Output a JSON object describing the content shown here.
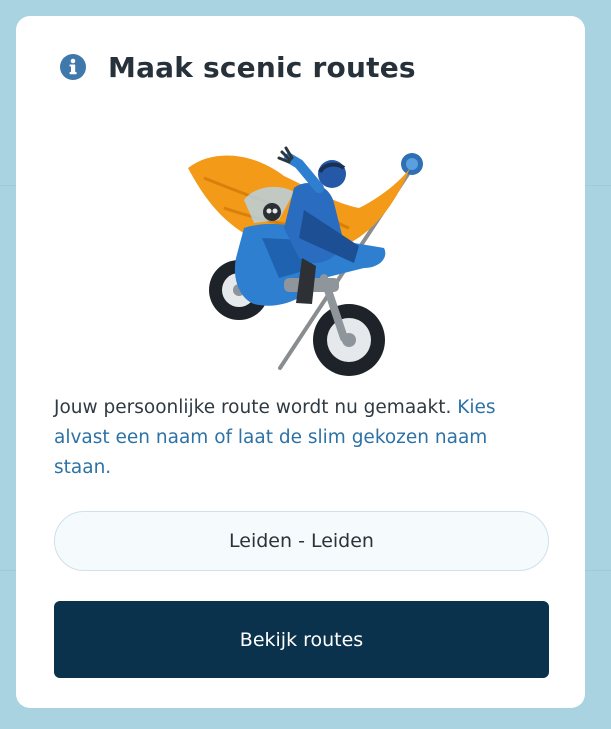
{
  "dialog": {
    "icon": "info-icon",
    "title": "Maak scenic routes",
    "illustration": "motorcycle-rider-with-flag",
    "message_plain": "Jouw persoonlijke route wordt nu gemaakt. ",
    "message_highlight": "Kies alvast een naam of laat de slim gekozen naam staan.",
    "route_name_value": "Leiden - Leiden",
    "primary_button_label": "Bekijk routes"
  },
  "colors": {
    "backdrop": "#a9d3e0",
    "card": "#ffffff",
    "title_text": "#27313a",
    "info_icon": "#3f78aa",
    "highlight_text": "#2d72a6",
    "input_background": "#f5fafd",
    "input_border": "#cfe1ec",
    "button_background": "#0b324c",
    "button_text": "#ffffff"
  }
}
